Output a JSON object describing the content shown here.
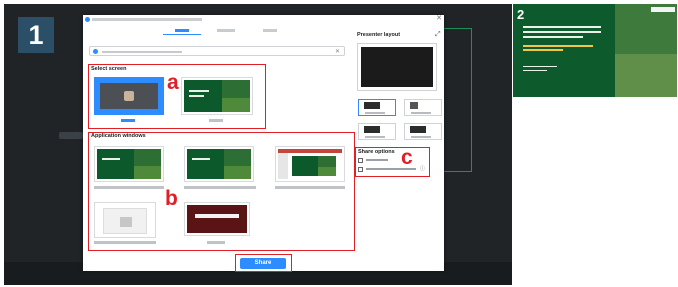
{
  "steps": {
    "one": "1",
    "two": "2"
  },
  "dialog": {
    "title": "",
    "close_icon": "close-icon",
    "tabs": [
      {
        "label": "",
        "active": true
      },
      {
        "label": "",
        "active": false
      },
      {
        "label": "",
        "active": false
      }
    ],
    "search_text": "",
    "select_screen_title": "Select screen",
    "screens": [
      {
        "label": "",
        "selected": true
      },
      {
        "label": "",
        "selected": false
      }
    ],
    "app_windows_title": "Application windows",
    "windows": [
      {
        "label": ""
      },
      {
        "label": ""
      },
      {
        "label": ""
      },
      {
        "label": ""
      },
      {
        "label": ""
      }
    ],
    "presenter_layout_title": "Presenter layout",
    "layouts": [
      {
        "label": "",
        "selected": true
      },
      {
        "label": "",
        "selected": false
      },
      {
        "label": "",
        "selected": false
      },
      {
        "label": "",
        "selected": false
      }
    ],
    "share_options_title": "Share options",
    "share_options": [
      {
        "label": "",
        "checked": false
      },
      {
        "label": "",
        "checked": false
      }
    ],
    "share_button": "Share"
  },
  "annotations": {
    "a": "a",
    "b": "b",
    "c": "c"
  },
  "colors": {
    "accent": "#2d8cff",
    "annotation": "#e01f26",
    "slide_green": "#0c5a2b",
    "dark_bg": "#202427"
  }
}
